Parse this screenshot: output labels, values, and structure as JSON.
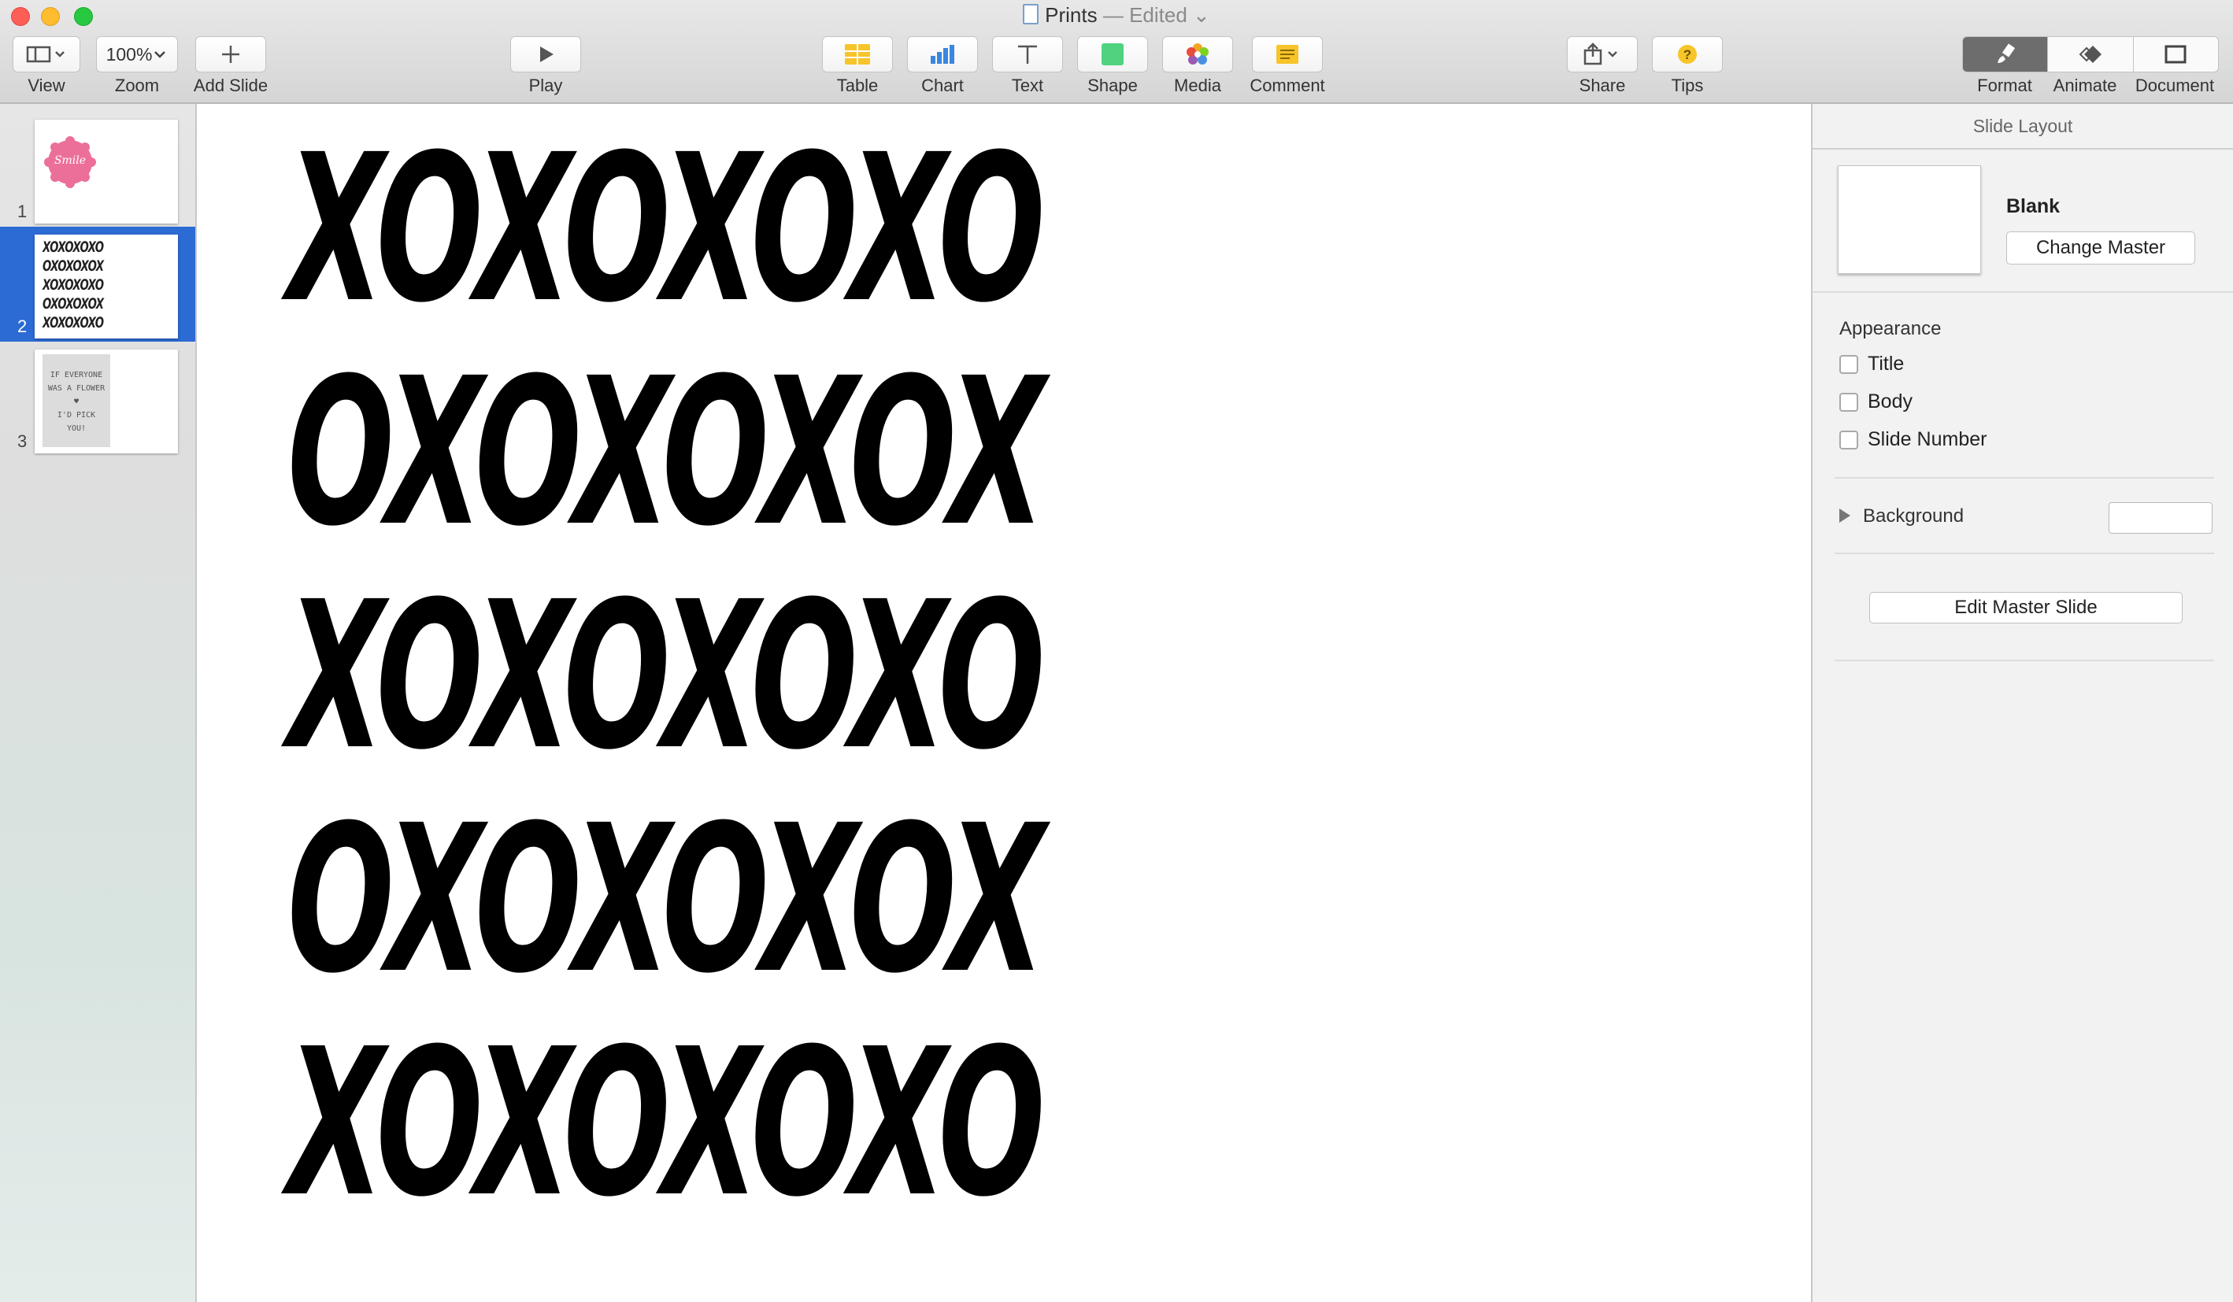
{
  "window": {
    "title": "Prints",
    "status": "— Edited"
  },
  "toolbar": {
    "view": "View",
    "zoom_value": "100%",
    "zoom": "Zoom",
    "add_slide": "Add Slide",
    "play": "Play",
    "table": "Table",
    "chart": "Chart",
    "text": "Text",
    "shape": "Shape",
    "media": "Media",
    "comment": "Comment",
    "share": "Share",
    "tips": "Tips",
    "format": "Format",
    "animate": "Animate",
    "document": "Document"
  },
  "navigator": {
    "slides": [
      {
        "number": "1",
        "thumb_text": "Smile"
      },
      {
        "number": "2",
        "thumb_lines": [
          "XOXOXOXO",
          "OXOXOXOX",
          "XOXOXOXO",
          "OXOXOXOX",
          "XOXOXOXO"
        ]
      },
      {
        "number": "3",
        "thumb_lines": [
          "IF EVERYONE",
          "WAS A FLOWER",
          "♥",
          "I'D PICK",
          "YOU!"
        ]
      }
    ],
    "selected": 2
  },
  "slide": {
    "lines": [
      "XOXOXOXO",
      "OXOXOXOX",
      "XOXOXOXO",
      "OXOXOXOX",
      "XOXOXOXO"
    ]
  },
  "inspector": {
    "header": "Slide Layout",
    "master_name": "Blank",
    "change_master": "Change Master",
    "appearance_title": "Appearance",
    "options": [
      "Title",
      "Body",
      "Slide Number"
    ],
    "background_label": "Background",
    "edit_master": "Edit Master Slide"
  },
  "colors": {
    "selection": "#2c6ad4",
    "thumb_flower": "#ec6f9a",
    "thumb3_bg": "#dcdcdc"
  }
}
